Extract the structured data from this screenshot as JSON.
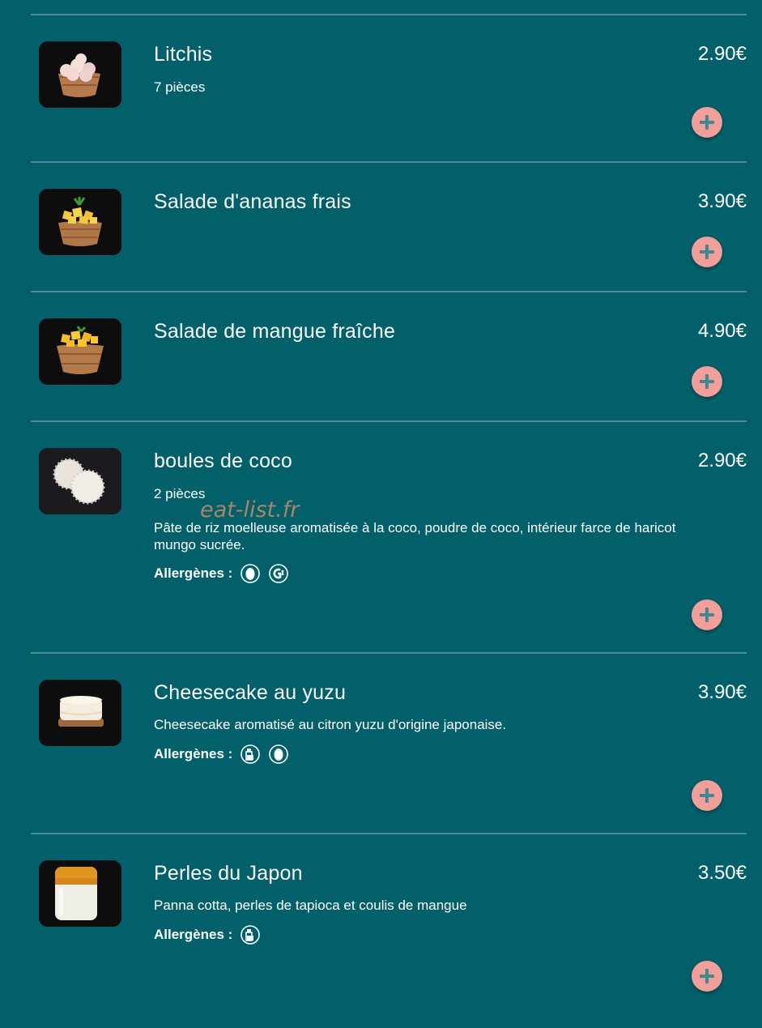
{
  "watermark": "eat-list.fr",
  "allergens_label": "Allergènes :",
  "colors": {
    "background": "#02606a",
    "divider": "#4f8d94",
    "add_button": "#f19f98",
    "add_icon": "#3e8a90"
  },
  "items": [
    {
      "name": "Litchis",
      "price": "2.90€",
      "pieces": "7 pièces",
      "image": "lychee-bowl"
    },
    {
      "name": "Salade d'ananas frais",
      "price": "3.90€",
      "image": "pineapple-bowl"
    },
    {
      "name": "Salade de mangue fraîche",
      "price": "4.90€",
      "image": "mango-bowl"
    },
    {
      "name": "boules de coco",
      "price": "2.90€",
      "pieces": "2 pièces",
      "description": "Pâte de riz moelleuse aromatisée à la coco, poudre de coco, intérieur farce de haricot mungo sucrée.",
      "allergens": [
        "egg-icon",
        "gluten-icon"
      ],
      "image": "coconut-balls"
    },
    {
      "name": "Cheesecake au yuzu",
      "price": "3.90€",
      "description": "Cheesecake aromatisé au citron yuzu d'origine japonaise.",
      "allergens": [
        "milk-icon",
        "egg-icon"
      ],
      "image": "cheesecake"
    },
    {
      "name": "Perles du Japon",
      "price": "3.50€",
      "description": "Panna cotta, perles de tapioca et coulis de mangue",
      "allergens": [
        "milk-icon"
      ],
      "image": "panna-cotta-glass"
    }
  ]
}
